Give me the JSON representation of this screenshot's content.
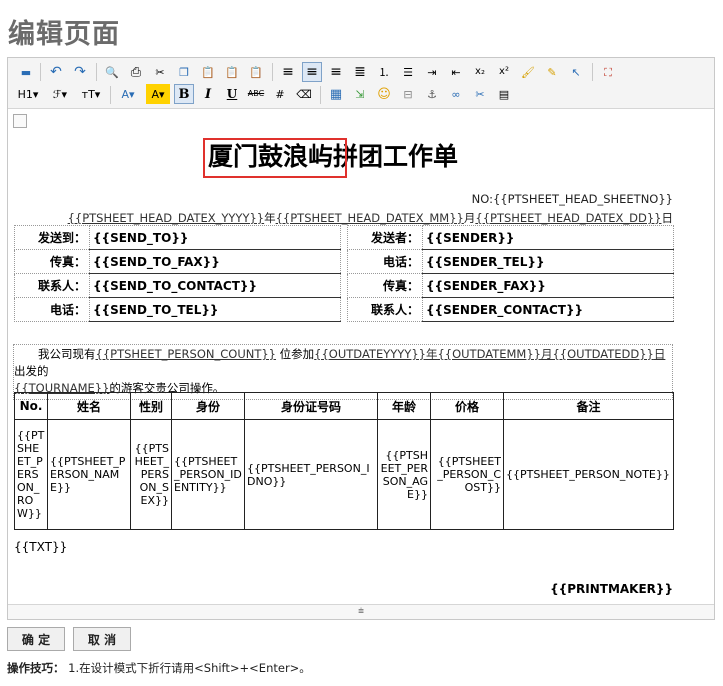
{
  "page_title": "编辑页面",
  "toolbar": {
    "row1": [
      {
        "name": "insert-frame-icon",
        "glyph": "▬"
      },
      {
        "name": "undo-icon",
        "glyph": "↶"
      },
      {
        "name": "redo-icon",
        "glyph": "↷"
      },
      {
        "name": "preview-icon",
        "glyph": "🔍"
      },
      {
        "name": "print-icon",
        "glyph": "⎙"
      },
      {
        "name": "cut-icon",
        "glyph": "✂"
      },
      {
        "name": "copy-icon",
        "glyph": "❐"
      },
      {
        "name": "paste-icon",
        "glyph": "📋"
      },
      {
        "name": "paste-text-icon",
        "glyph": "📋"
      },
      {
        "name": "paste-word-icon",
        "glyph": "📋"
      },
      {
        "name": "align-left-icon",
        "glyph": "≡"
      },
      {
        "name": "align-center-icon",
        "glyph": "≡"
      },
      {
        "name": "align-right-icon",
        "glyph": "≡"
      },
      {
        "name": "align-justify-icon",
        "glyph": "≣"
      },
      {
        "name": "ordered-list-icon",
        "glyph": "⒈"
      },
      {
        "name": "unordered-list-icon",
        "glyph": "☰"
      },
      {
        "name": "indent-icon",
        "glyph": "⇥"
      },
      {
        "name": "outdent-icon",
        "glyph": "⇤"
      },
      {
        "name": "subscript-icon",
        "glyph": "x₂"
      },
      {
        "name": "superscript-icon",
        "glyph": "x²"
      },
      {
        "name": "clear-format-brush-icon",
        "glyph": "🖌"
      },
      {
        "name": "format-painter-icon",
        "glyph": "✎"
      },
      {
        "name": "select-pointer-icon",
        "glyph": "↖"
      },
      {
        "name": "fullscreen-icon",
        "glyph": "⛶"
      }
    ],
    "row2": [
      {
        "name": "heading-dropdown",
        "glyph": "H1▾"
      },
      {
        "name": "font-family-dropdown",
        "glyph": "ℱ▾"
      },
      {
        "name": "font-size-dropdown",
        "glyph": "тT▾"
      },
      {
        "name": "font-color-icon",
        "glyph": "A▾"
      },
      {
        "name": "highlight-color-icon",
        "glyph": "A▾"
      },
      {
        "name": "bold-icon",
        "glyph": "B"
      },
      {
        "name": "italic-icon",
        "glyph": "I"
      },
      {
        "name": "underline-icon",
        "glyph": "U"
      },
      {
        "name": "strikethrough-icon",
        "glyph": "ABC"
      },
      {
        "name": "special-char-icon",
        "glyph": "#"
      },
      {
        "name": "eraser-icon",
        "glyph": "⌫"
      },
      {
        "name": "table-icon",
        "glyph": "▦"
      },
      {
        "name": "insert-row-icon",
        "glyph": "⇲"
      },
      {
        "name": "emoticon-icon",
        "glyph": "☺"
      },
      {
        "name": "page-break-icon",
        "glyph": "⊟"
      },
      {
        "name": "anchor-icon",
        "glyph": "⚓"
      },
      {
        "name": "link-icon",
        "glyph": "∞"
      },
      {
        "name": "unlink-icon",
        "glyph": "✂"
      },
      {
        "name": "template-icon",
        "glyph": "▤"
      }
    ]
  },
  "document": {
    "title": "厦门鼓浪屿拼团工作单",
    "sheet_no": "NO:{{PTSHEET_HEAD_SHEETNO}}",
    "date_line": {
      "yyyy": "{{PTSHEET_HEAD_DATEX_YYYY}}",
      "y_sep": "年",
      "mm": "{{PTSHEET_HEAD_DATEX_MM}}",
      "m_sep": "月",
      "dd": "{{PTSHEET_HEAD_DATEX_DD}}",
      "d_sep": "日"
    },
    "left_table": [
      {
        "label": "发送到：",
        "value": "{{SEND_TO}}"
      },
      {
        "label": "传真：",
        "value": "{{SEND_TO_FAX}}"
      },
      {
        "label": "联系人：",
        "value": "{{SEND_TO_CONTACT}}"
      },
      {
        "label": "电话：",
        "value": "{{SEND_TO_TEL}}"
      }
    ],
    "right_table": [
      {
        "label": "发送者：",
        "value": "{{SENDER}}"
      },
      {
        "label": "电话：",
        "value": "{{SENDER_TEL}}"
      },
      {
        "label": "传真：",
        "value": "{{SENDER_FAX}}"
      },
      {
        "label": "联系人：",
        "value": "{{SENDER_CONTACT}}"
      }
    ],
    "paragraph": {
      "p1": "我公司现有",
      "count": "{{PTSHEET_PERSON_COUNT}}",
      "p2": " 位参加",
      "yyyy": "{{OUTDATEYYYY}}",
      "y_sep": "年",
      "mm": "{{OUTDATEMM}}",
      "m_sep": "月",
      "dd": "{{OUTDATEDD}}",
      "d_sep": "日",
      "p3": " 出发的",
      "tour": "{{TOURNAME}}",
      "p4": "的游客交贵公司操作。"
    },
    "person_table": {
      "headers": [
        "No.",
        "姓名",
        "性别",
        "身份",
        "身份证号码",
        "年龄",
        "价格",
        "备注"
      ],
      "row": [
        "{{PTSHEET_PERSON_ROW}}",
        "{{PTSHEET_PERSON_NAME}}",
        "{{PTSHEET_PERSON_SEX}}",
        "{{PTSHEET_PERSON_IDENTITY}}",
        "{{PTSHEET_PERSON_IDNO}}",
        "{{PTSHEET_PERSON_AGE}}",
        "{{PTSHEET_PERSON_COST}}",
        "{{PTSHEET_PERSON_NOTE}}"
      ]
    },
    "txt": "{{TXT}}",
    "printmaker": "{{PRINTMAKER}}"
  },
  "buttons": {
    "confirm": "确 定",
    "cancel": "取 消"
  },
  "tips": {
    "label": "操作技巧：",
    "text": "1.在设计模式下折行请用<Shift>+<Enter>。"
  }
}
